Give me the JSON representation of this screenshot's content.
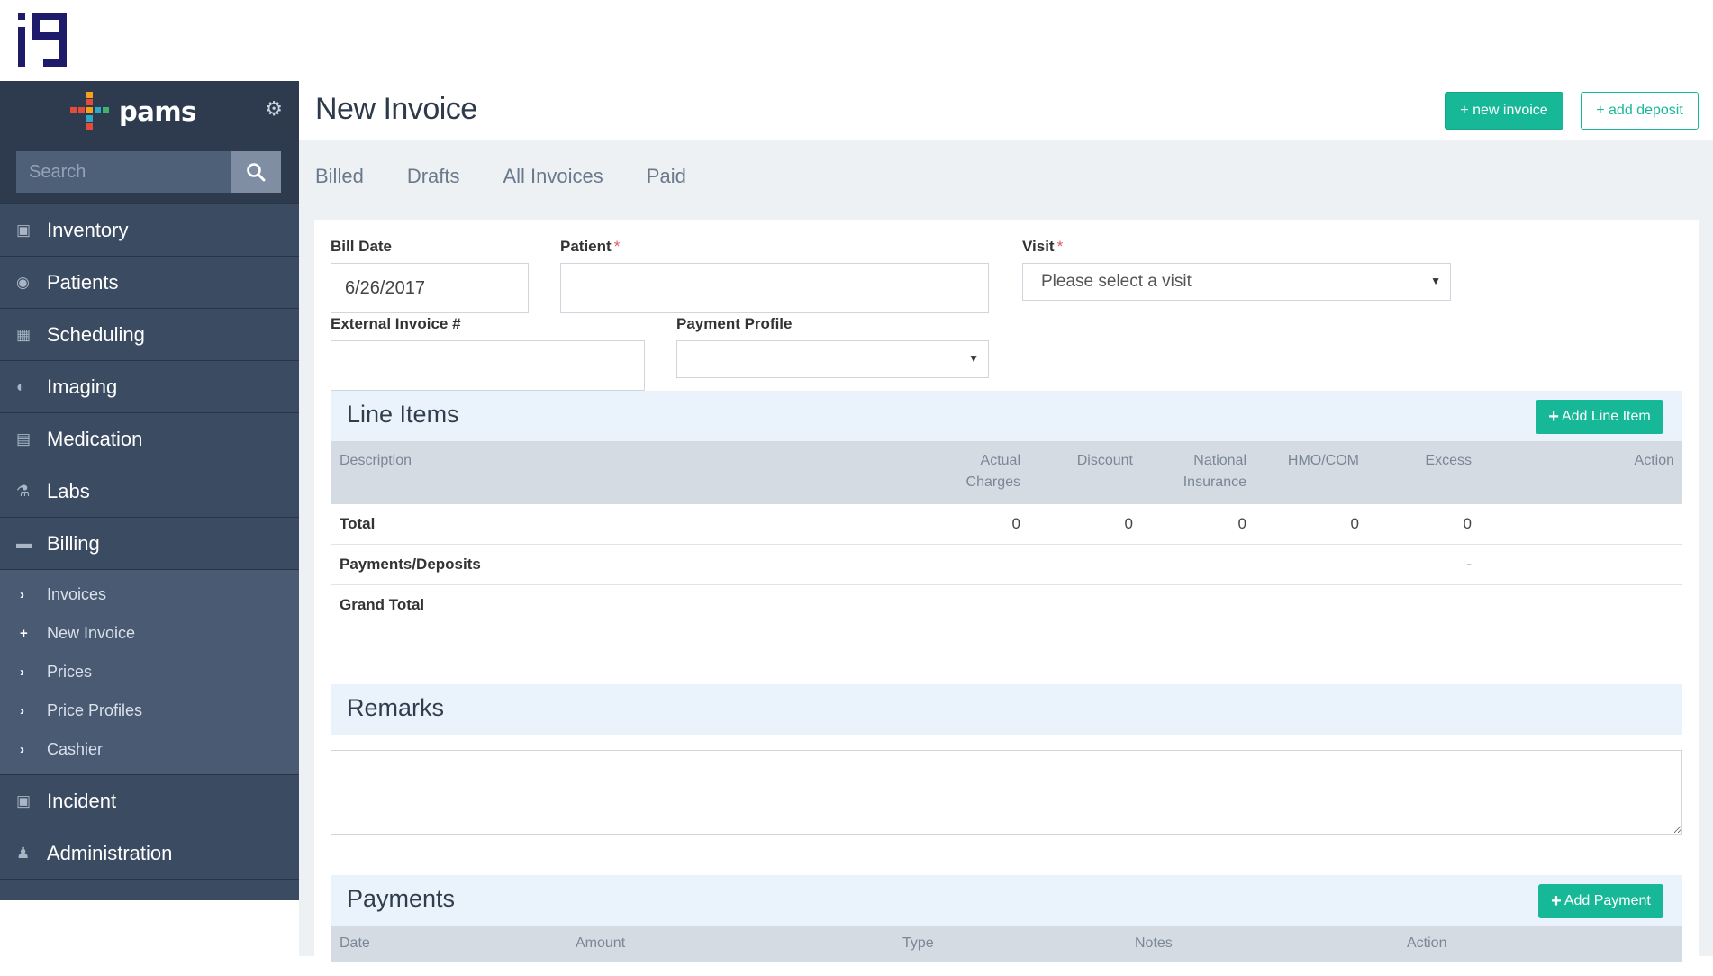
{
  "sidebar": {
    "brand": "pams",
    "search_placeholder": "Search",
    "nav": [
      {
        "label": "Inventory",
        "icon": "box-icon"
      },
      {
        "label": "Patients",
        "icon": "globe-icon"
      },
      {
        "label": "Scheduling",
        "icon": "calendar-icon"
      },
      {
        "label": "Imaging",
        "icon": "camera-icon"
      },
      {
        "label": "Medication",
        "icon": "document-icon"
      },
      {
        "label": "Labs",
        "icon": "microscope-icon"
      },
      {
        "label": "Billing",
        "icon": "credit-card-icon"
      }
    ],
    "billing_sub": [
      {
        "label": "Invoices",
        "icon": "chevron-right-icon"
      },
      {
        "label": "New Invoice",
        "icon": "plus-icon"
      },
      {
        "label": "Prices",
        "icon": "chevron-right-icon"
      },
      {
        "label": "Price Profiles",
        "icon": "chevron-right-icon"
      },
      {
        "label": "Cashier",
        "icon": "chevron-right-icon"
      }
    ],
    "nav_bottom": [
      {
        "label": "Incident",
        "icon": "box-icon"
      },
      {
        "label": "Administration",
        "icon": "person-icon"
      }
    ]
  },
  "header": {
    "title": "New Invoice",
    "new_invoice": "+ new invoice",
    "add_deposit": "+ add deposit"
  },
  "tabs": [
    "Billed",
    "Drafts",
    "All Invoices",
    "Paid"
  ],
  "form": {
    "bill_date_label": "Bill Date",
    "bill_date_value": "6/26/2017",
    "patient_label": "Patient",
    "patient_value": "",
    "visit_label": "Visit",
    "visit_value": "Please select a visit",
    "external_label": "External Invoice #",
    "external_value": "",
    "payment_profile_label": "Payment Profile",
    "payment_profile_value": "",
    "required_mark": "*"
  },
  "line_items": {
    "title": "Line Items",
    "add_label": "Add Line Item",
    "columns": [
      "Description",
      "Actual Charges",
      "Discount",
      "National Insurance",
      "HMO/COM",
      "Excess",
      "Action"
    ],
    "total_label": "Total",
    "totals": [
      "0",
      "0",
      "0",
      "0",
      "0"
    ],
    "payments_label": "Payments/Deposits",
    "payments_excess": "-",
    "grand_total_label": "Grand Total"
  },
  "remarks": {
    "title": "Remarks",
    "value": ""
  },
  "payments": {
    "title": "Payments",
    "add_label": "Add Payment",
    "columns": [
      "Date",
      "Amount",
      "Type",
      "Notes",
      "Action"
    ]
  },
  "colors": {
    "sidebar": "#3b4b62",
    "accent": "#17b897",
    "logo": "#1f1b6b"
  }
}
